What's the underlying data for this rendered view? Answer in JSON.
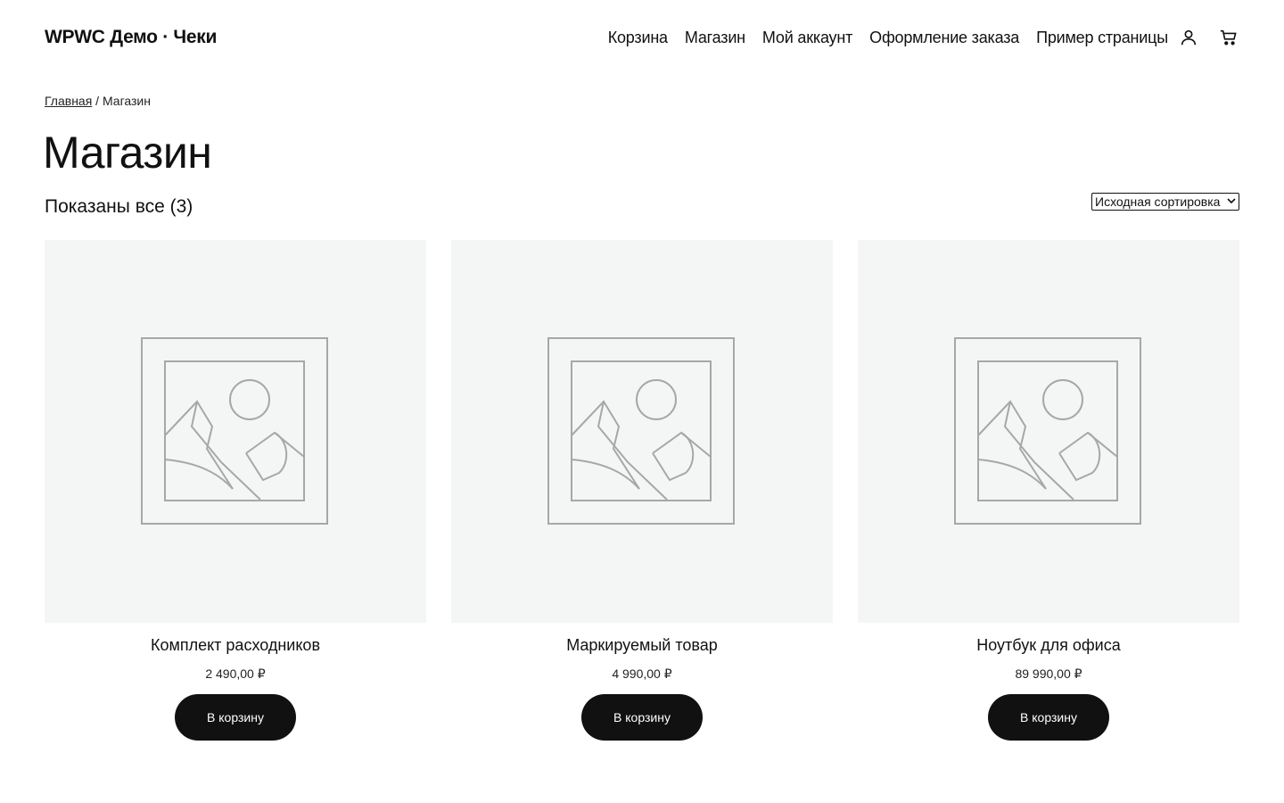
{
  "header": {
    "site_title": "WPWC Демо · Чеки",
    "nav": [
      {
        "label": "Корзина"
      },
      {
        "label": "Магазин"
      },
      {
        "label": "Мой аккаунт"
      },
      {
        "label": "Оформление заказа"
      },
      {
        "label": "Пример страницы"
      }
    ],
    "icons": [
      "account-icon",
      "cart-icon"
    ]
  },
  "breadcrumb": {
    "home": "Главная",
    "separator": " / ",
    "current": "Магазин"
  },
  "page": {
    "title": "Магазин",
    "result_count": "Показаны все (3)",
    "ordering_selected": "Исходная сортировка"
  },
  "products": [
    {
      "name": "Комплект расходников",
      "price": "2 490,00 ₽",
      "button": "В корзину",
      "image_icon": "placeholder-image-icon"
    },
    {
      "name": "Маркируемый товар",
      "price": "4 990,00 ₽",
      "button": "В корзину",
      "image_icon": "placeholder-image-icon"
    },
    {
      "name": "Ноутбук для офиса",
      "price": "89 990,00 ₽",
      "button": "В корзину",
      "image_icon": "placeholder-image-icon"
    }
  ],
  "colors": {
    "text": "#111111",
    "button_bg": "#111111",
    "button_text": "#ffffff",
    "image_bg": "#f4f6f5",
    "placeholder_stroke": "#a7a7a7"
  }
}
